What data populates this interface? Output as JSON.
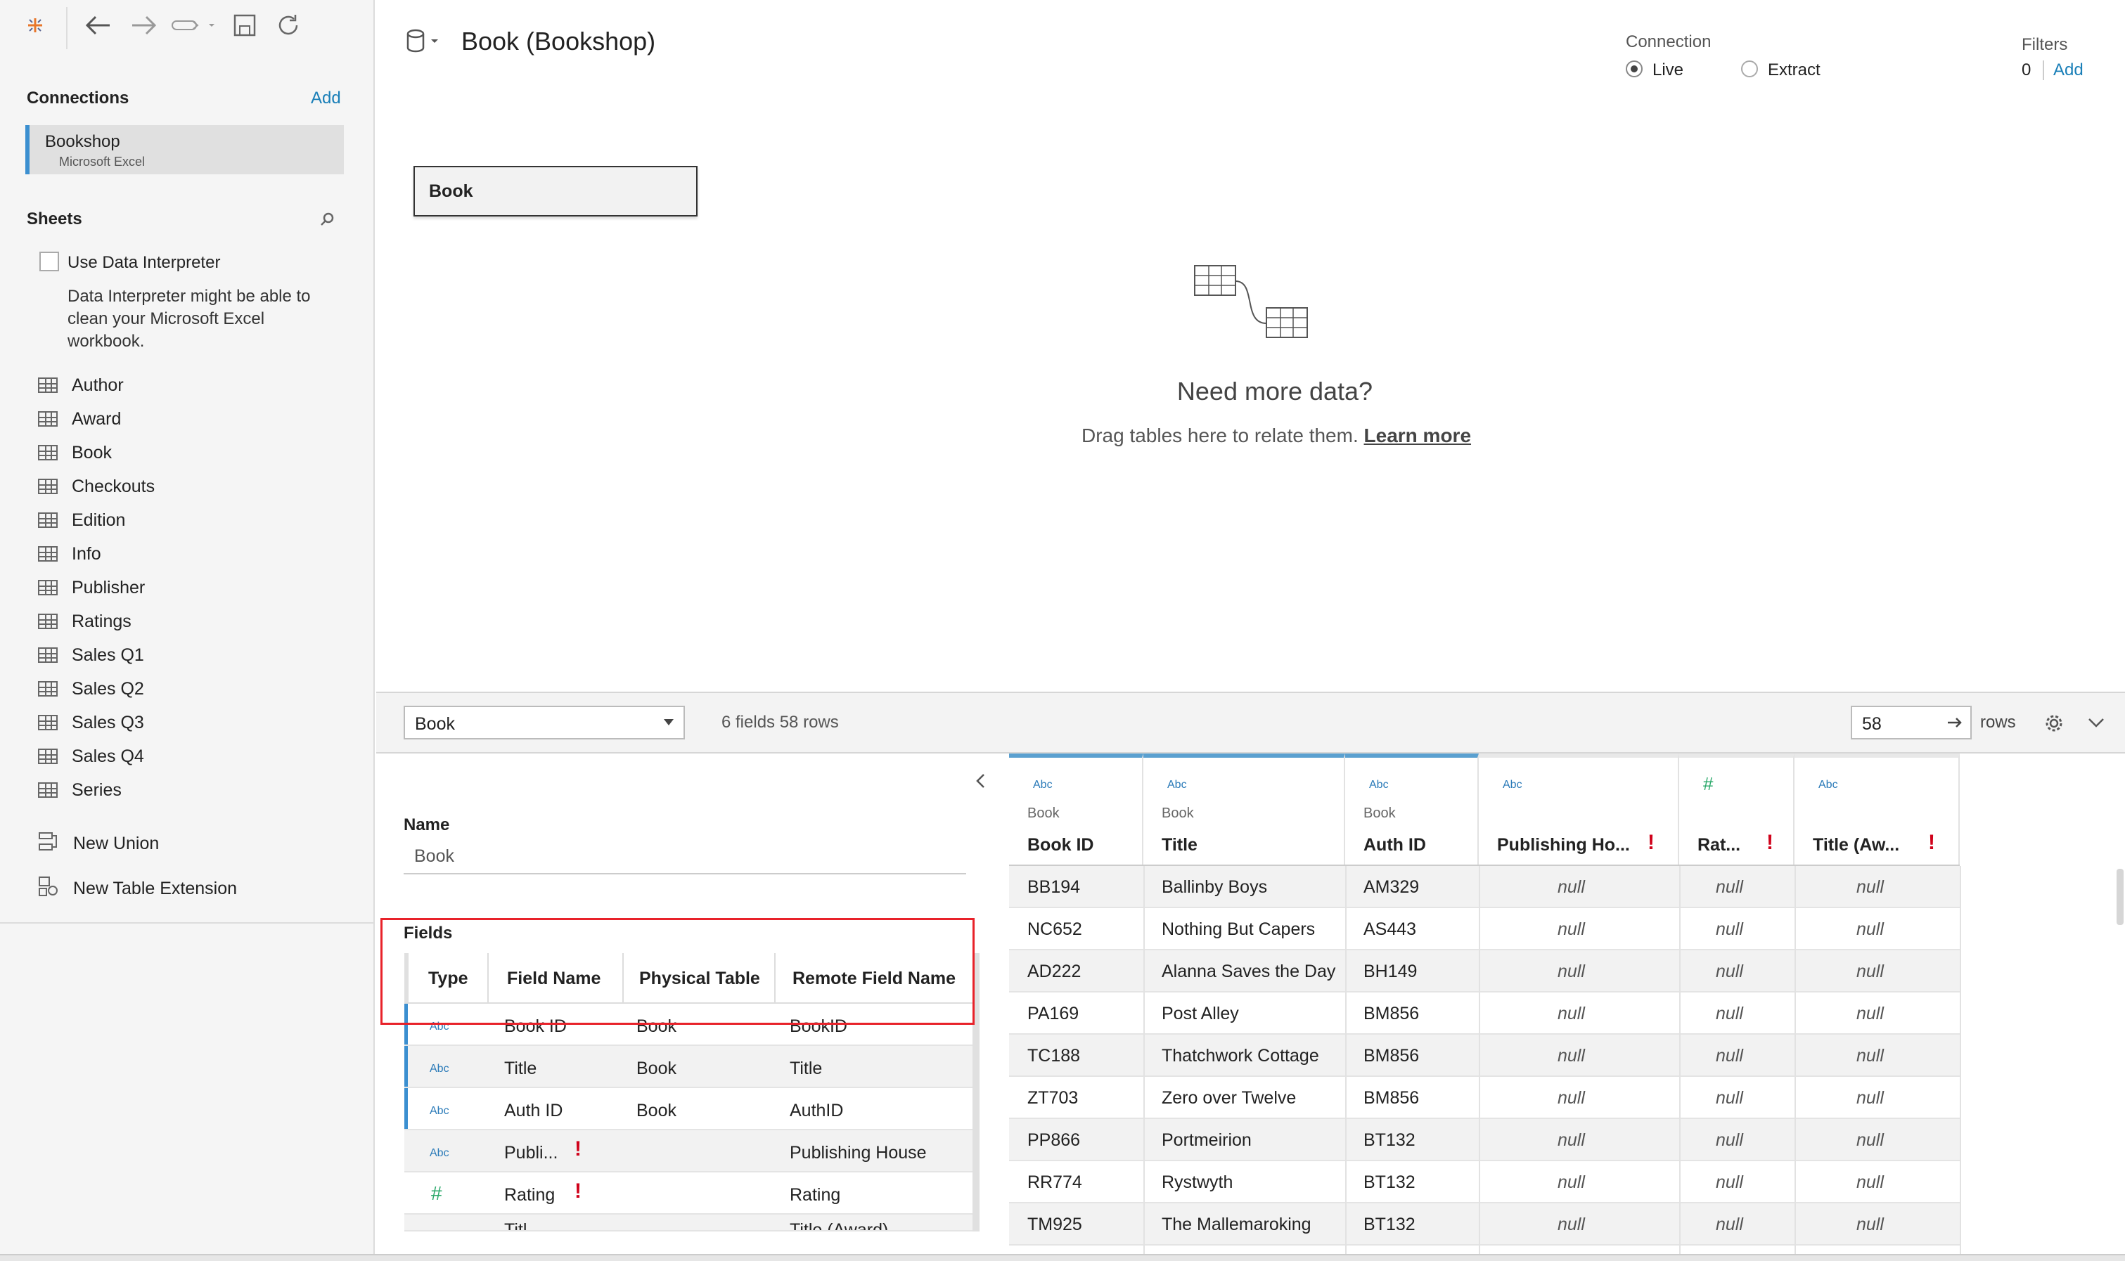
{
  "app": {
    "datasource_title": "Book (Bookshop)"
  },
  "toolbar": {
    "undo": "undo",
    "redo": "redo",
    "pause": "pause",
    "save": "save",
    "refresh": "refresh"
  },
  "connections": {
    "title": "Connections",
    "add": "Add",
    "items": [
      {
        "name": "Bookshop",
        "type": "Microsoft Excel"
      }
    ]
  },
  "sheets": {
    "title": "Sheets",
    "interpreter_label": "Use Data Interpreter",
    "interpreter_hint_lines": [
      "Data Interpreter might be able to",
      "clean your Microsoft Excel",
      "workbook."
    ],
    "items": [
      "Author",
      "Award",
      "Book",
      "Checkouts",
      "Edition",
      "Info",
      "Publisher",
      "Ratings",
      "Sales Q1",
      "Sales Q2",
      "Sales Q3",
      "Sales Q4",
      "Series"
    ],
    "new_union": "New Union",
    "new_table_extension": "New Table Extension"
  },
  "connection": {
    "label": "Connection",
    "live": "Live",
    "extract": "Extract",
    "selected": "Live"
  },
  "filters": {
    "label": "Filters",
    "count": "0",
    "add": "Add"
  },
  "canvas": {
    "table_box": "Book",
    "empty_title": "Need more data?",
    "empty_text": "Drag tables here to relate them.",
    "learn_more": "Learn more"
  },
  "bottom": {
    "table_select": "Book",
    "summary": "6 fields 58 rows",
    "rows_value": "58",
    "rows_label": "rows"
  },
  "details": {
    "name_label": "Name",
    "name_value": "Book",
    "fields_label": "Fields",
    "columns": [
      "Type",
      "Field Name",
      "Physical Table",
      "Remote Field Name"
    ],
    "rows": [
      {
        "type": "Abc",
        "field": "Book ID",
        "table": "Book",
        "remote": "BookID",
        "linked": true,
        "warn": false
      },
      {
        "type": "Abc",
        "field": "Title",
        "table": "Book",
        "remote": "Title",
        "linked": true,
        "warn": false
      },
      {
        "type": "Abc",
        "field": "Auth ID",
        "table": "Book",
        "remote": "AuthID",
        "linked": true,
        "warn": false
      },
      {
        "type": "Abc",
        "field": "Publi...",
        "table": "",
        "remote": "Publishing House",
        "linked": false,
        "warn": true
      },
      {
        "type": "#",
        "field": "Rating",
        "table": "",
        "remote": "Rating",
        "linked": false,
        "warn": true
      },
      {
        "type": "",
        "field": "Titl...",
        "table": "",
        "remote": "Title (Award)",
        "linked": false,
        "warn": true
      }
    ]
  },
  "grid": {
    "columns": [
      {
        "type": "Abc",
        "source": "Book",
        "name": "Book ID"
      },
      {
        "type": "Abc",
        "source": "Book",
        "name": "Title"
      },
      {
        "type": "Abc",
        "source": "Book",
        "name": "Auth ID"
      },
      {
        "type": "Abc",
        "source": "",
        "name": "Publishing Ho..."
      },
      {
        "type": "#",
        "source": "",
        "name": "Rat..."
      },
      {
        "type": "Abc",
        "source": "",
        "name": "Title (Aw..."
      }
    ],
    "rows": [
      [
        "BB194",
        "Ballinby Boys",
        "AM329",
        "null",
        "null",
        "null"
      ],
      [
        "NC652",
        "Nothing But Capers",
        "AS443",
        "null",
        "null",
        "null"
      ],
      [
        "AD222",
        "Alanna Saves the Day",
        "BH149",
        "null",
        "null",
        "null"
      ],
      [
        "PA169",
        "Post Alley",
        "BM856",
        "null",
        "null",
        "null"
      ],
      [
        "TC188",
        "Thatchwork Cottage",
        "BM856",
        "null",
        "null",
        "null"
      ],
      [
        "ZT703",
        "Zero over Twelve",
        "BM856",
        "null",
        "null",
        "null"
      ],
      [
        "PP866",
        "Portmeirion",
        "BT132",
        "null",
        "null",
        "null"
      ],
      [
        "RR774",
        "Rystwyth",
        "BT132",
        "null",
        "null",
        "null"
      ],
      [
        "TM925",
        "The Mallemaroking",
        "BT132",
        "null",
        "null",
        "null"
      ]
    ]
  },
  "colors": {
    "accent": "#1a7fb8",
    "highlight": "#e8222a",
    "warn": "#d0021b",
    "active_bar": "#3b8fd0"
  }
}
